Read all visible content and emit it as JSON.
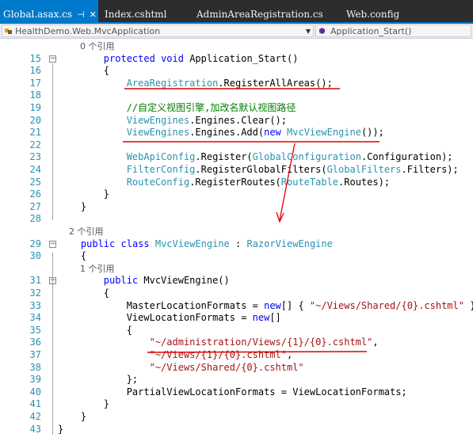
{
  "tabs": [
    {
      "label": "Global.asax.cs",
      "active": true
    },
    {
      "label": "Index.cshtml",
      "active": false
    },
    {
      "label": "AdminAreaRegistration.cs",
      "active": false
    },
    {
      "label": "Web.config",
      "active": false
    }
  ],
  "tab_pin_icon": "pin-icon",
  "tab_close_icon": "close-icon",
  "nav": {
    "project": "HealthDemo.Web.MvcApplication",
    "member": "Application_Start()"
  },
  "colors": {
    "keyword": "#0000ff",
    "type": "#2b91af",
    "comment": "#008000",
    "string": "#a31515",
    "line_number": "#2b91af",
    "accent": "#007acc",
    "annotation": "#e00000"
  },
  "lines": [
    {
      "n": "",
      "fold": "",
      "tokens": [
        {
          "t": "ref",
          "v": "        0 个引用"
        }
      ]
    },
    {
      "n": "15",
      "fold": "-",
      "tokens": [
        {
          "t": "id",
          "v": "        "
        },
        {
          "t": "kw",
          "v": "protected"
        },
        {
          "t": "id",
          "v": " "
        },
        {
          "t": "kw",
          "v": "void"
        },
        {
          "t": "id",
          "v": " Application_Start()"
        }
      ]
    },
    {
      "n": "16",
      "fold": "",
      "tokens": [
        {
          "t": "id",
          "v": "        {"
        }
      ]
    },
    {
      "n": "17",
      "fold": "",
      "tokens": [
        {
          "t": "id",
          "v": "            "
        },
        {
          "t": "ty",
          "v": "AreaRegistration"
        },
        {
          "t": "id",
          "v": ".RegisterAllAreas();"
        }
      ]
    },
    {
      "n": "18",
      "fold": "",
      "tokens": []
    },
    {
      "n": "19",
      "fold": "",
      "tokens": [
        {
          "t": "id",
          "v": "            "
        },
        {
          "t": "cm",
          "v": "//自定义视图引擎,加改名默认视图路径"
        }
      ]
    },
    {
      "n": "20",
      "fold": "",
      "tokens": [
        {
          "t": "id",
          "v": "            "
        },
        {
          "t": "ty",
          "v": "ViewEngines"
        },
        {
          "t": "id",
          "v": ".Engines.Clear();"
        }
      ]
    },
    {
      "n": "21",
      "fold": "",
      "tokens": [
        {
          "t": "id",
          "v": "            "
        },
        {
          "t": "ty",
          "v": "ViewEngines"
        },
        {
          "t": "id",
          "v": ".Engines.Add("
        },
        {
          "t": "kw",
          "v": "new"
        },
        {
          "t": "id",
          "v": " "
        },
        {
          "t": "ty",
          "v": "MvcViewEngine"
        },
        {
          "t": "id",
          "v": "());"
        }
      ]
    },
    {
      "n": "22",
      "fold": "",
      "tokens": []
    },
    {
      "n": "23",
      "fold": "",
      "tokens": [
        {
          "t": "id",
          "v": "            "
        },
        {
          "t": "ty",
          "v": "WebApiConfig"
        },
        {
          "t": "id",
          "v": ".Register("
        },
        {
          "t": "ty",
          "v": "GlobalConfiguration"
        },
        {
          "t": "id",
          "v": ".Configuration);"
        }
      ]
    },
    {
      "n": "24",
      "fold": "",
      "tokens": [
        {
          "t": "id",
          "v": "            "
        },
        {
          "t": "ty",
          "v": "FilterConfig"
        },
        {
          "t": "id",
          "v": ".RegisterGlobalFilters("
        },
        {
          "t": "ty",
          "v": "GlobalFilters"
        },
        {
          "t": "id",
          "v": ".Filters);"
        }
      ]
    },
    {
      "n": "25",
      "fold": "",
      "tokens": [
        {
          "t": "id",
          "v": "            "
        },
        {
          "t": "ty",
          "v": "RouteConfig"
        },
        {
          "t": "id",
          "v": ".RegisterRoutes("
        },
        {
          "t": "ty",
          "v": "RouteTable"
        },
        {
          "t": "id",
          "v": ".Routes);"
        }
      ]
    },
    {
      "n": "26",
      "fold": "",
      "tokens": [
        {
          "t": "id",
          "v": "        }"
        }
      ]
    },
    {
      "n": "27",
      "fold": "",
      "tokens": [
        {
          "t": "id",
          "v": "    }"
        }
      ]
    },
    {
      "n": "28",
      "fold": "",
      "tokens": []
    },
    {
      "n": "",
      "fold": "",
      "tokens": [
        {
          "t": "ref",
          "v": "    2 个引用"
        }
      ]
    },
    {
      "n": "29",
      "fold": "-",
      "tokens": [
        {
          "t": "id",
          "v": "    "
        },
        {
          "t": "kw",
          "v": "public"
        },
        {
          "t": "id",
          "v": " "
        },
        {
          "t": "kw",
          "v": "class"
        },
        {
          "t": "id",
          "v": " "
        },
        {
          "t": "ty",
          "v": "MvcViewEngine"
        },
        {
          "t": "id",
          "v": " : "
        },
        {
          "t": "ty",
          "v": "RazorViewEngine"
        }
      ]
    },
    {
      "n": "30",
      "fold": "",
      "tokens": [
        {
          "t": "id",
          "v": "    {"
        }
      ]
    },
    {
      "n": "",
      "fold": "",
      "tokens": [
        {
          "t": "ref",
          "v": "        1 个引用"
        }
      ]
    },
    {
      "n": "31",
      "fold": "-",
      "tokens": [
        {
          "t": "id",
          "v": "        "
        },
        {
          "t": "kw",
          "v": "public"
        },
        {
          "t": "id",
          "v": " MvcViewEngine()"
        }
      ]
    },
    {
      "n": "32",
      "fold": "",
      "tokens": [
        {
          "t": "id",
          "v": "        {"
        }
      ]
    },
    {
      "n": "33",
      "fold": "",
      "tokens": [
        {
          "t": "id",
          "v": "            MasterLocationFormats = "
        },
        {
          "t": "kw",
          "v": "new"
        },
        {
          "t": "id",
          "v": "[] { "
        },
        {
          "t": "st",
          "v": "\"~/Views/Shared/{0}.cshtml\""
        },
        {
          "t": "id",
          "v": " };"
        }
      ]
    },
    {
      "n": "34",
      "fold": "",
      "tokens": [
        {
          "t": "id",
          "v": "            ViewLocationFormats = "
        },
        {
          "t": "kw",
          "v": "new"
        },
        {
          "t": "id",
          "v": "[]"
        }
      ]
    },
    {
      "n": "35",
      "fold": "",
      "tokens": [
        {
          "t": "id",
          "v": "            {"
        }
      ]
    },
    {
      "n": "36",
      "fold": "",
      "tokens": [
        {
          "t": "id",
          "v": "                "
        },
        {
          "t": "st",
          "v": "\"~/administration/Views/{1}/{0}.cshtml\""
        },
        {
          "t": "id",
          "v": ","
        }
      ]
    },
    {
      "n": "37",
      "fold": "",
      "tokens": [
        {
          "t": "id",
          "v": "                "
        },
        {
          "t": "st",
          "v": "\"~/Views/{1}/{0}.cshtml\""
        },
        {
          "t": "id",
          "v": ","
        }
      ]
    },
    {
      "n": "38",
      "fold": "",
      "tokens": [
        {
          "t": "id",
          "v": "                "
        },
        {
          "t": "st",
          "v": "\"~/Views/Shared/{0}.cshtml\""
        }
      ]
    },
    {
      "n": "39",
      "fold": "",
      "tokens": [
        {
          "t": "id",
          "v": "            };"
        }
      ]
    },
    {
      "n": "40",
      "fold": "",
      "tokens": [
        {
          "t": "id",
          "v": "            PartialViewLocationFormats = ViewLocationFormats;"
        }
      ]
    },
    {
      "n": "41",
      "fold": "",
      "tokens": [
        {
          "t": "id",
          "v": "        }"
        }
      ]
    },
    {
      "n": "42",
      "fold": "",
      "tokens": [
        {
          "t": "id",
          "v": "    }"
        }
      ]
    },
    {
      "n": "43",
      "fold": "",
      "tokens": [
        {
          "t": "id",
          "v": "}"
        }
      ]
    }
  ]
}
